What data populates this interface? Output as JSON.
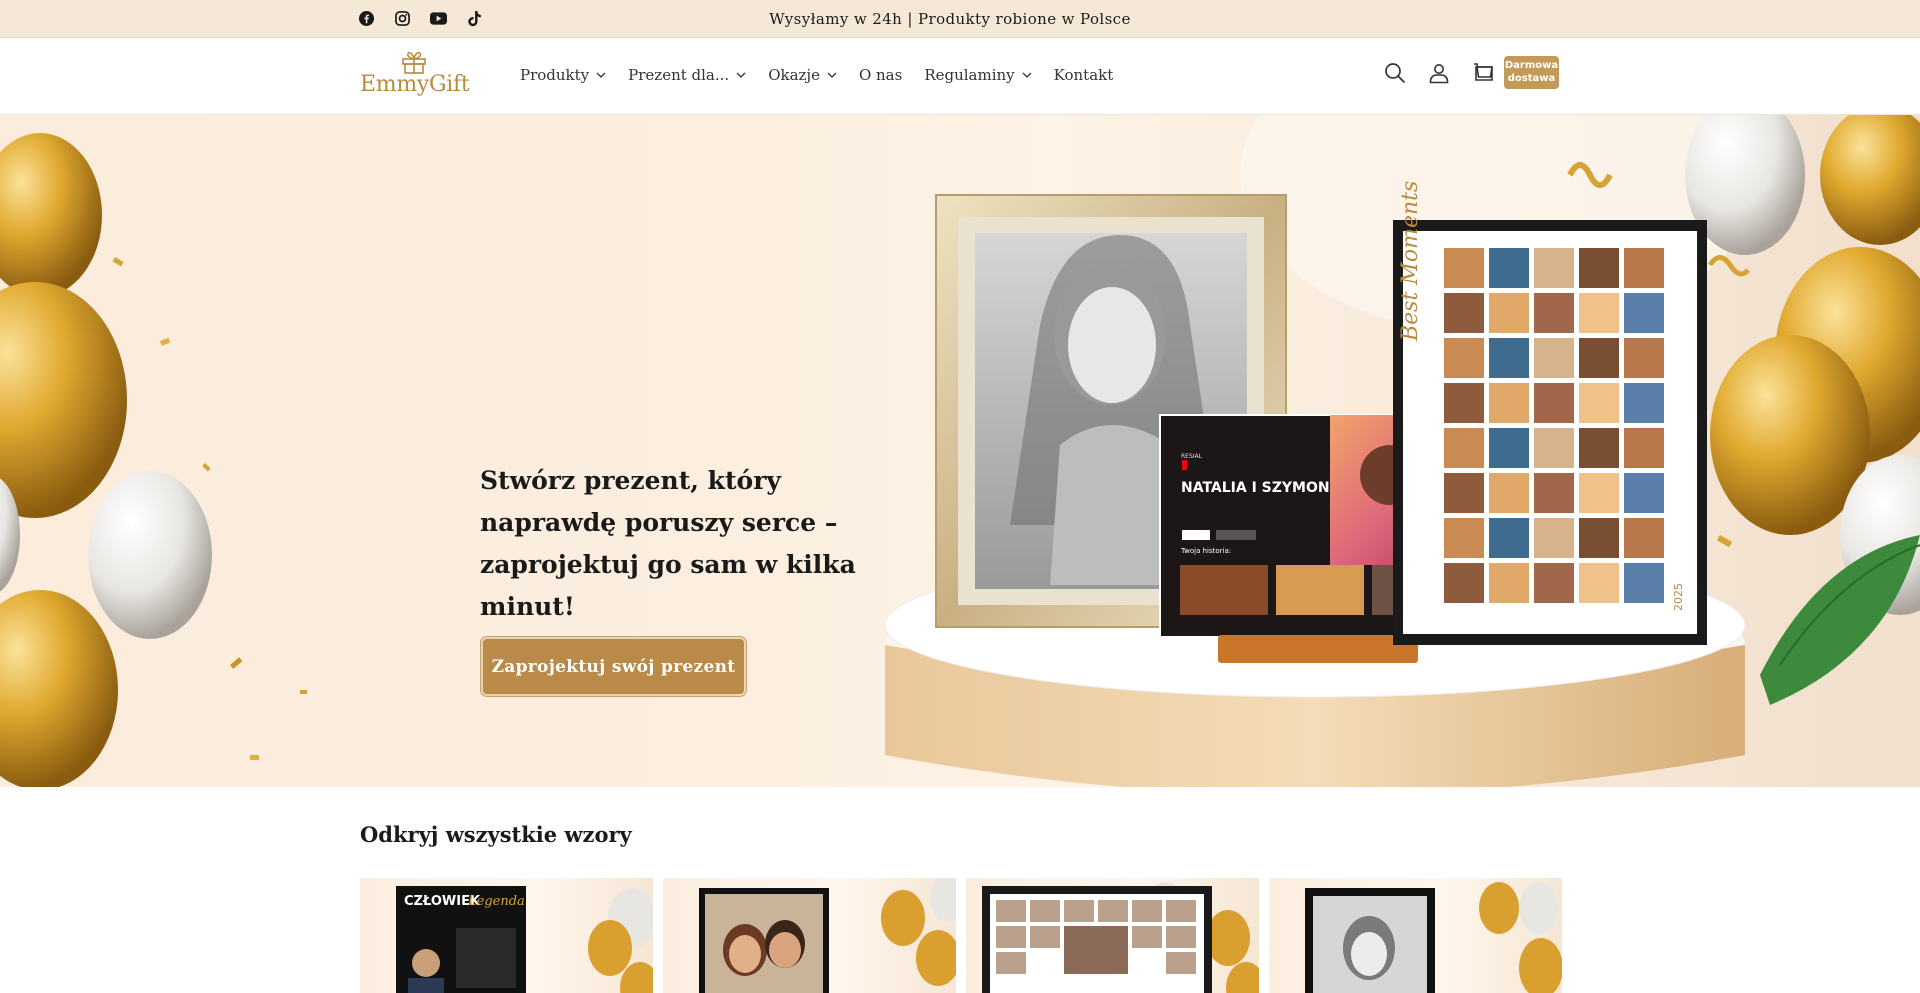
{
  "announcement": {
    "text": "Wysyłamy w 24h | Produkty robione w Polsce"
  },
  "social": {
    "icons": [
      "facebook-icon",
      "instagram-icon",
      "youtube-icon",
      "tiktok-icon"
    ]
  },
  "logo": {
    "text": "EmmyGift"
  },
  "nav": {
    "items": [
      {
        "label": "Produkty",
        "dropdown": true
      },
      {
        "label": "Prezent dla...",
        "dropdown": true
      },
      {
        "label": "Okazje",
        "dropdown": true
      },
      {
        "label": "O nas",
        "dropdown": false
      },
      {
        "label": "Regulaminy",
        "dropdown": true
      },
      {
        "label": "Kontakt",
        "dropdown": false
      }
    ]
  },
  "header": {
    "icons": [
      "search-icon",
      "account-icon",
      "cart-icon"
    ],
    "badge_line1": "Darmowa",
    "badge_line2": "dostawa"
  },
  "hero": {
    "heading": "Stwórz prezent, który naprawdę poruszy serce – zaprojektuj go sam w kilka minut!",
    "cta_label": "Zaprojektuj swój prezent",
    "product_netflix_title": "NATALIA I SZYMON",
    "product_netflix_brand": "RESIAL",
    "product_netflix_section": "Twoja historia:",
    "product_collage_title": "Best Moments",
    "product_collage_year": "2025"
  },
  "collections": {
    "title": "Odkryj wszystkie wzory",
    "cards": [
      {
        "label_line1": "CZŁOWIEK",
        "label_line2": "Legenda"
      },
      {
        "label_line1": ""
      },
      {
        "label_line1": ""
      },
      {
        "label_line1": ""
      }
    ]
  },
  "colors": {
    "accent": "#b98a48",
    "topbar_bg": "#f5e8d6",
    "logo": "#b98a3e",
    "gold": "#d1a030"
  }
}
